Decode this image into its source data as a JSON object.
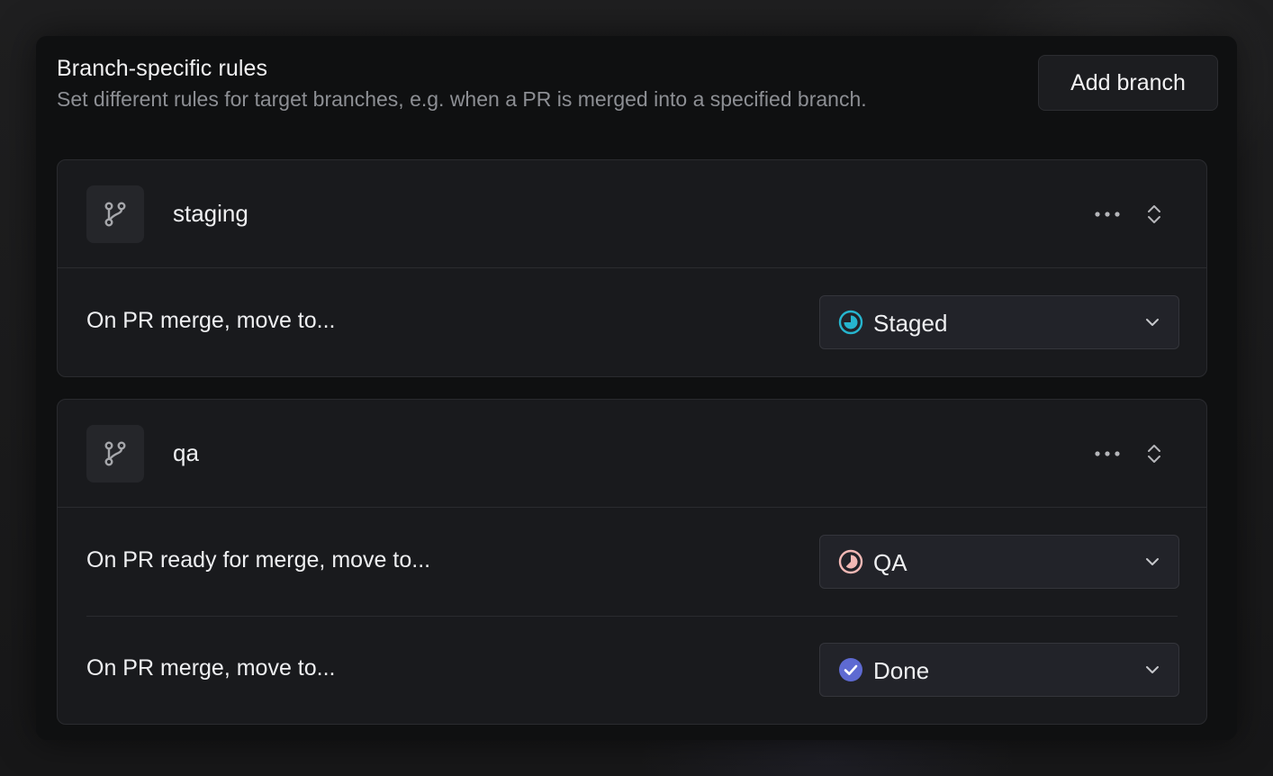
{
  "header": {
    "title": "Branch-specific rules",
    "subtitle": "Set different rules for target branches, e.g. when a PR is merged into a specified branch.",
    "add_button_label": "Add branch"
  },
  "branches": [
    {
      "name": "staging",
      "icon": "git-branch-icon",
      "rules": [
        {
          "label": "On PR merge, move to...",
          "status": "Staged",
          "status_icon": "staged-status-icon",
          "status_color": "#26b5ce"
        }
      ]
    },
    {
      "name": "qa",
      "icon": "git-branch-icon",
      "rules": [
        {
          "label": "On PR ready for merge, move to...",
          "status": "QA",
          "status_icon": "qa-status-icon",
          "status_color": "#f2b8b5"
        },
        {
          "label": "On PR merge, move to...",
          "status": "Done",
          "status_icon": "done-status-icon",
          "status_color": "#5e6ad2"
        }
      ]
    }
  ],
  "colors": {
    "panel_bg": "#0f1011",
    "card_bg": "#191a1d",
    "border": "#2a2b2f",
    "text_primary": "#eeeff1",
    "text_secondary": "#8d8f94"
  }
}
